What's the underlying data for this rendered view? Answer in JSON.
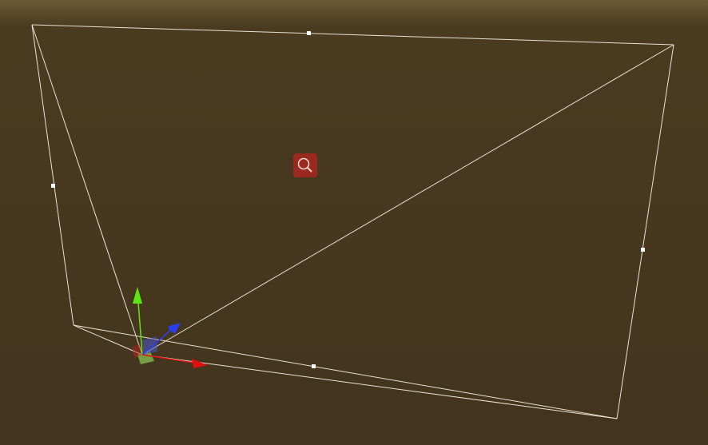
{
  "scene_view": {
    "background": {
      "top": "#6a5a36",
      "mid": "#4a3a20",
      "bottom": "#43341d"
    },
    "frustum": {
      "line_color": "#e8e2d2",
      "handle_color": "#ffffff"
    },
    "gizmo": {
      "x_axis_color": "#e01010",
      "y_axis_color": "#5ee614",
      "z_axis_color": "#2a3ff0",
      "plane_color": "#7fb04a"
    },
    "camera_icon": {
      "name": "magnifier-icon",
      "background": "#9a2a20",
      "foreground": "#f0d6cc"
    }
  }
}
